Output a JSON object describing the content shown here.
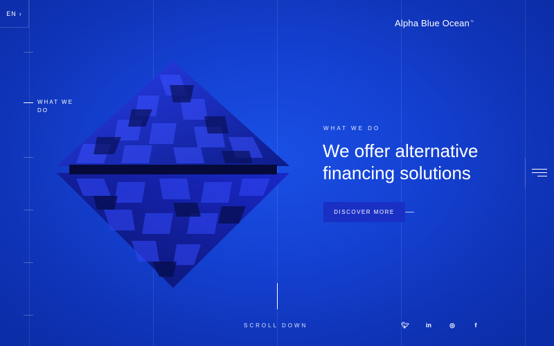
{
  "header": {
    "language": "EN",
    "language_arrow": "›",
    "logo": "Alpha Blue Ocean",
    "logo_tm": "™"
  },
  "sidebar": {
    "section_label": "WHAT WE DO"
  },
  "hero": {
    "eyebrow": "WHAT WE DO",
    "headline": "We offer alternative financing solutions",
    "cta_label": "DISCOVER MORE"
  },
  "footer": {
    "scroll_label": "SCROLL DOWN",
    "socials": [
      {
        "icon": "twitter-icon",
        "glyph": "🐦︎"
      },
      {
        "icon": "linkedin-icon",
        "glyph": "in"
      },
      {
        "icon": "instagram-icon",
        "glyph": "◎"
      },
      {
        "icon": "facebook-icon",
        "glyph": "f"
      }
    ]
  },
  "colors": {
    "background": "#1440d0",
    "button": "#1a2fc4",
    "crystal_dark": "#0a1670",
    "crystal_light": "#2b40f2"
  }
}
